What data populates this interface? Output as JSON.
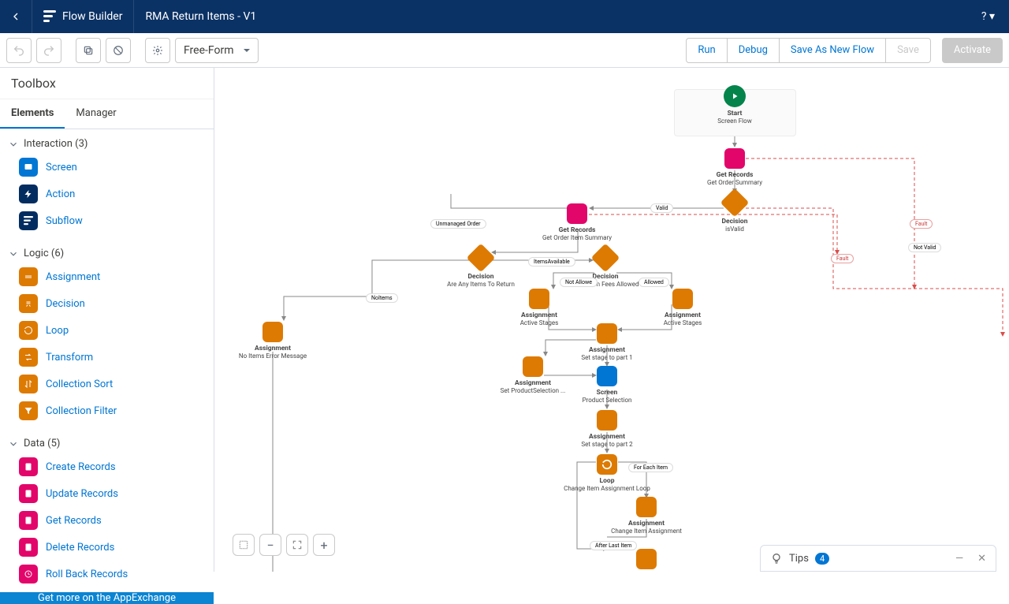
{
  "header": {
    "brand": "Flow Builder",
    "title": "RMA Return Items - V1"
  },
  "toolbar": {
    "layout_mode": "Free-Form",
    "run": "Run",
    "debug": "Debug",
    "saveas": "Save As New Flow",
    "save": "Save",
    "activate": "Activate"
  },
  "sidebar": {
    "title": "Toolbox",
    "tabs": {
      "elements": "Elements",
      "manager": "Manager"
    },
    "sections": {
      "interaction": {
        "label": "Interaction (3)",
        "items": [
          "Screen",
          "Action",
          "Subflow"
        ]
      },
      "logic": {
        "label": "Logic (6)",
        "items": [
          "Assignment",
          "Decision",
          "Loop",
          "Transform",
          "Collection Sort",
          "Collection Filter"
        ]
      },
      "data": {
        "label": "Data (5)",
        "items": [
          "Create Records",
          "Update Records",
          "Get Records",
          "Delete Records",
          "Roll Back Records"
        ]
      }
    },
    "footer": "Get more on the AppExchange"
  },
  "flow": {
    "start": {
      "title": "Start",
      "sub": "Screen Flow"
    },
    "nodes": {
      "gr1": {
        "title": "Get Records",
        "sub": "Get Order Summary"
      },
      "d1": {
        "title": "Decision",
        "sub": "isValid"
      },
      "gr2": {
        "title": "Get Records",
        "sub": "Get Order Item Summary"
      },
      "d2": {
        "title": "Decision",
        "sub": "Are Any Items To Return"
      },
      "d3": {
        "title": "Decision",
        "sub": "No Return Fees Allowed"
      },
      "a_noitems": {
        "title": "Assignment",
        "sub": "No Items Error Message"
      },
      "a_stages_l": {
        "title": "Assignment",
        "sub": "Active Stages"
      },
      "a_stages_r": {
        "title": "Assignment",
        "sub": "Active Stages"
      },
      "a_part1": {
        "title": "Assignment",
        "sub": "Set stage to part 1"
      },
      "a_setps": {
        "title": "Assignment",
        "sub": "Set ProductSelection ..."
      },
      "scr": {
        "title": "Screen",
        "sub": "Product Selection"
      },
      "a_part2": {
        "title": "Assignment",
        "sub": "Set stage to part 2"
      },
      "loop": {
        "title": "Loop",
        "sub": "Change Item Assignment Loop"
      },
      "a_chg": {
        "title": "Assignment",
        "sub": "Change Item Assignment"
      },
      "a_bot": {
        "title": "Assignment",
        "sub": ""
      }
    },
    "labels": {
      "unmanaged": "Unmanaged Order",
      "valid": "Valid",
      "notvalid": "Not Valid",
      "fault1": "Fault",
      "fault2": "Fault",
      "itemsavail": "ItemsAvailable",
      "noitems": "NoItems",
      "notallowed": "Not Allowe",
      "allowed": "Allowed",
      "foreach": "For Each Item",
      "afterlast": "After Last Item"
    }
  },
  "tips": {
    "label": "Tips",
    "count": "4"
  }
}
